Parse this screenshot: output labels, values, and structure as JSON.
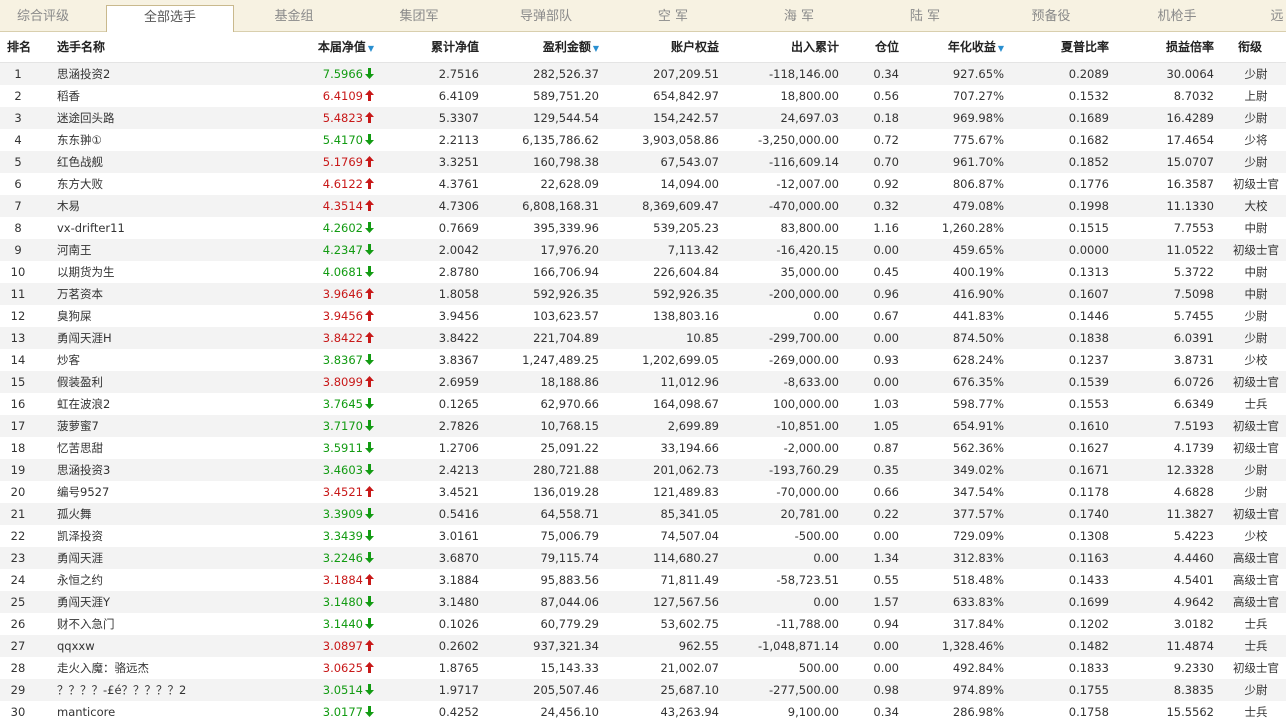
{
  "tabs": [
    "综合评级",
    "全部选手",
    "基金组",
    "集团军",
    "导弹部队",
    "空 军",
    "海 军",
    "陆 军",
    "预备役",
    "机枪手",
    "远"
  ],
  "active_tab": 1,
  "headers": {
    "rank": "排名",
    "name": "选手名称",
    "cur_nav": "本届净值",
    "cum_nav": "累计净值",
    "profit": "盈利金额",
    "equity": "账户权益",
    "flow": "出入累计",
    "position": "仓位",
    "annual": "年化收益",
    "sharpe": "夏普比率",
    "pl_ratio": "损益倍率",
    "title": "衔级"
  },
  "sort_indicator": "▼",
  "colors": {
    "up": "#c81818",
    "down": "#129b12",
    "accent": "#2a8fd0"
  },
  "rows": [
    {
      "rank": "1",
      "name": "思涵投资2",
      "nav": "7.5966",
      "dir": "down",
      "cum": "2.7516",
      "profit": "282,526.37",
      "equity": "207,209.51",
      "flow": "-118,146.00",
      "pos": "0.34",
      "annual": "927.65%",
      "sharpe": "0.2089",
      "pl": "30.0064",
      "title": "少尉"
    },
    {
      "rank": "2",
      "name": "稻香",
      "nav": "6.4109",
      "dir": "up",
      "cum": "6.4109",
      "profit": "589,751.20",
      "equity": "654,842.97",
      "flow": "18,800.00",
      "pos": "0.56",
      "annual": "707.27%",
      "sharpe": "0.1532",
      "pl": "8.7032",
      "title": "上尉"
    },
    {
      "rank": "3",
      "name": "迷途回头路",
      "nav": "5.4823",
      "dir": "up",
      "cum": "5.3307",
      "profit": "129,544.54",
      "equity": "154,242.57",
      "flow": "24,697.03",
      "pos": "0.18",
      "annual": "969.98%",
      "sharpe": "0.1689",
      "pl": "16.4289",
      "title": "少尉"
    },
    {
      "rank": "4",
      "name": "东东翀①",
      "nav": "5.4170",
      "dir": "down",
      "cum": "2.2113",
      "profit": "6,135,786.62",
      "equity": "3,903,058.86",
      "flow": "-3,250,000.00",
      "pos": "0.72",
      "annual": "775.67%",
      "sharpe": "0.1682",
      "pl": "17.4654",
      "title": "少将"
    },
    {
      "rank": "5",
      "name": "红色战舰",
      "nav": "5.1769",
      "dir": "up",
      "cum": "3.3251",
      "profit": "160,798.38",
      "equity": "67,543.07",
      "flow": "-116,609.14",
      "pos": "0.70",
      "annual": "961.70%",
      "sharpe": "0.1852",
      "pl": "15.0707",
      "title": "少尉"
    },
    {
      "rank": "6",
      "name": "东方大败",
      "nav": "4.6122",
      "dir": "up",
      "cum": "4.3761",
      "profit": "22,628.09",
      "equity": "14,094.00",
      "flow": "-12,007.00",
      "pos": "0.92",
      "annual": "806.87%",
      "sharpe": "0.1776",
      "pl": "16.3587",
      "title": "初级士官"
    },
    {
      "rank": "7",
      "name": "木易",
      "nav": "4.3514",
      "dir": "up",
      "cum": "4.7306",
      "profit": "6,808,168.31",
      "equity": "8,369,609.47",
      "flow": "-470,000.00",
      "pos": "0.32",
      "annual": "479.08%",
      "sharpe": "0.1998",
      "pl": "11.1330",
      "title": "大校"
    },
    {
      "rank": "8",
      "name": "vx-drifter11",
      "nav": "4.2602",
      "dir": "down",
      "cum": "0.7669",
      "profit": "395,339.96",
      "equity": "539,205.23",
      "flow": "83,800.00",
      "pos": "1.16",
      "annual": "1,260.28%",
      "sharpe": "0.1515",
      "pl": "7.7553",
      "title": "中尉"
    },
    {
      "rank": "9",
      "name": "河南王",
      "nav": "4.2347",
      "dir": "down",
      "cum": "2.0042",
      "profit": "17,976.20",
      "equity": "7,113.42",
      "flow": "-16,420.15",
      "pos": "0.00",
      "annual": "459.65%",
      "sharpe": "0.0000",
      "pl": "11.0522",
      "title": "初级士官"
    },
    {
      "rank": "10",
      "name": "以期货为生",
      "nav": "4.0681",
      "dir": "down",
      "cum": "2.8780",
      "profit": "166,706.94",
      "equity": "226,604.84",
      "flow": "35,000.00",
      "pos": "0.45",
      "annual": "400.19%",
      "sharpe": "0.1313",
      "pl": "5.3722",
      "title": "中尉"
    },
    {
      "rank": "11",
      "name": "万茗资本",
      "nav": "3.9646",
      "dir": "up",
      "cum": "1.8058",
      "profit": "592,926.35",
      "equity": "592,926.35",
      "flow": "-200,000.00",
      "pos": "0.96",
      "annual": "416.90%",
      "sharpe": "0.1607",
      "pl": "7.5098",
      "title": "中尉"
    },
    {
      "rank": "12",
      "name": "臭狗屎",
      "nav": "3.9456",
      "dir": "up",
      "cum": "3.9456",
      "profit": "103,623.57",
      "equity": "138,803.16",
      "flow": "0.00",
      "pos": "0.67",
      "annual": "441.83%",
      "sharpe": "0.1446",
      "pl": "5.7455",
      "title": "少尉"
    },
    {
      "rank": "13",
      "name": "勇闯天涯H",
      "nav": "3.8422",
      "dir": "up",
      "cum": "3.8422",
      "profit": "221,704.89",
      "equity": "10.85",
      "flow": "-299,700.00",
      "pos": "0.00",
      "annual": "874.50%",
      "sharpe": "0.1838",
      "pl": "6.0391",
      "title": "少尉"
    },
    {
      "rank": "14",
      "name": "炒客",
      "nav": "3.8367",
      "dir": "down",
      "cum": "3.8367",
      "profit": "1,247,489.25",
      "equity": "1,202,699.05",
      "flow": "-269,000.00",
      "pos": "0.93",
      "annual": "628.24%",
      "sharpe": "0.1237",
      "pl": "3.8731",
      "title": "少校"
    },
    {
      "rank": "15",
      "name": "假装盈利",
      "nav": "3.8099",
      "dir": "up",
      "cum": "2.6959",
      "profit": "18,188.86",
      "equity": "11,012.96",
      "flow": "-8,633.00",
      "pos": "0.00",
      "annual": "676.35%",
      "sharpe": "0.1539",
      "pl": "6.0726",
      "title": "初级士官"
    },
    {
      "rank": "16",
      "name": "虹在波浪2",
      "nav": "3.7645",
      "dir": "down",
      "cum": "0.1265",
      "profit": "62,970.66",
      "equity": "164,098.67",
      "flow": "100,000.00",
      "pos": "1.03",
      "annual": "598.77%",
      "sharpe": "0.1553",
      "pl": "6.6349",
      "title": "士兵"
    },
    {
      "rank": "17",
      "name": "菠萝蜜7",
      "nav": "3.7170",
      "dir": "down",
      "cum": "2.7826",
      "profit": "10,768.15",
      "equity": "2,699.89",
      "flow": "-10,851.00",
      "pos": "1.05",
      "annual": "654.91%",
      "sharpe": "0.1610",
      "pl": "7.5193",
      "title": "初级士官"
    },
    {
      "rank": "18",
      "name": "忆苦思甜",
      "nav": "3.5911",
      "dir": "down",
      "cum": "1.2706",
      "profit": "25,091.22",
      "equity": "33,194.66",
      "flow": "-2,000.00",
      "pos": "0.87",
      "annual": "562.36%",
      "sharpe": "0.1627",
      "pl": "4.1739",
      "title": "初级士官"
    },
    {
      "rank": "19",
      "name": "思涵投资3",
      "nav": "3.4603",
      "dir": "down",
      "cum": "2.4213",
      "profit": "280,721.88",
      "equity": "201,062.73",
      "flow": "-193,760.29",
      "pos": "0.35",
      "annual": "349.02%",
      "sharpe": "0.1671",
      "pl": "12.3328",
      "title": "少尉"
    },
    {
      "rank": "20",
      "name": "编号9527",
      "nav": "3.4521",
      "dir": "up",
      "cum": "3.4521",
      "profit": "136,019.28",
      "equity": "121,489.83",
      "flow": "-70,000.00",
      "pos": "0.66",
      "annual": "347.54%",
      "sharpe": "0.1178",
      "pl": "4.6828",
      "title": "少尉"
    },
    {
      "rank": "21",
      "name": "孤火舞",
      "nav": "3.3909",
      "dir": "down",
      "cum": "0.5416",
      "profit": "64,558.71",
      "equity": "85,341.05",
      "flow": "20,781.00",
      "pos": "0.22",
      "annual": "377.57%",
      "sharpe": "0.1740",
      "pl": "11.3827",
      "title": "初级士官"
    },
    {
      "rank": "22",
      "name": "凯泽投资",
      "nav": "3.3439",
      "dir": "down",
      "cum": "3.0161",
      "profit": "75,006.79",
      "equity": "74,507.04",
      "flow": "-500.00",
      "pos": "0.00",
      "annual": "729.09%",
      "sharpe": "0.1308",
      "pl": "5.4223",
      "title": "少校"
    },
    {
      "rank": "23",
      "name": "勇闯天涯",
      "nav": "3.2246",
      "dir": "down",
      "cum": "3.6870",
      "profit": "79,115.74",
      "equity": "114,680.27",
      "flow": "0.00",
      "pos": "1.34",
      "annual": "312.83%",
      "sharpe": "0.1163",
      "pl": "4.4460",
      "title": "高级士官"
    },
    {
      "rank": "24",
      "name": "永恒之约",
      "nav": "3.1884",
      "dir": "up",
      "cum": "3.1884",
      "profit": "95,883.56",
      "equity": "71,811.49",
      "flow": "-58,723.51",
      "pos": "0.55",
      "annual": "518.48%",
      "sharpe": "0.1433",
      "pl": "4.5401",
      "title": "高级士官"
    },
    {
      "rank": "25",
      "name": "勇闯天涯Y",
      "nav": "3.1480",
      "dir": "down",
      "cum": "3.1480",
      "profit": "87,044.06",
      "equity": "127,567.56",
      "flow": "0.00",
      "pos": "1.57",
      "annual": "633.83%",
      "sharpe": "0.1699",
      "pl": "4.9642",
      "title": "高级士官"
    },
    {
      "rank": "26",
      "name": "财不入急门",
      "nav": "3.1440",
      "dir": "down",
      "cum": "0.1026",
      "profit": "60,779.29",
      "equity": "53,602.75",
      "flow": "-11,788.00",
      "pos": "0.94",
      "annual": "317.84%",
      "sharpe": "0.1202",
      "pl": "3.0182",
      "title": "士兵"
    },
    {
      "rank": "27",
      "name": "qqxxw",
      "nav": "3.0897",
      "dir": "up",
      "cum": "0.2602",
      "profit": "937,321.34",
      "equity": "962.55",
      "flow": "-1,048,871.14",
      "pos": "0.00",
      "annual": "1,328.46%",
      "sharpe": "0.1482",
      "pl": "11.4874",
      "title": "士兵"
    },
    {
      "rank": "28",
      "name": "走火入魔：骆远杰",
      "nav": "3.0625",
      "dir": "up",
      "cum": "1.8765",
      "profit": "15,143.33",
      "equity": "21,002.07",
      "flow": "500.00",
      "pos": "0.00",
      "annual": "492.84%",
      "sharpe": "0.1833",
      "pl": "9.2330",
      "title": "初级士官"
    },
    {
      "rank": "29",
      "name": "？？？？-£é？？？？？2",
      "nav": "3.0514",
      "dir": "down",
      "cum": "1.9717",
      "profit": "205,507.46",
      "equity": "25,687.10",
      "flow": "-277,500.00",
      "pos": "0.98",
      "annual": "974.89%",
      "sharpe": "0.1755",
      "pl": "8.3835",
      "title": "少尉"
    },
    {
      "rank": "30",
      "name": "manticore",
      "nav": "3.0177",
      "dir": "down",
      "cum": "0.4252",
      "profit": "24,456.10",
      "equity": "43,263.94",
      "flow": "9,100.00",
      "pos": "0.34",
      "annual": "286.98%",
      "sharpe": "0.1758",
      "pl": "15.5562",
      "title": "士兵"
    }
  ]
}
